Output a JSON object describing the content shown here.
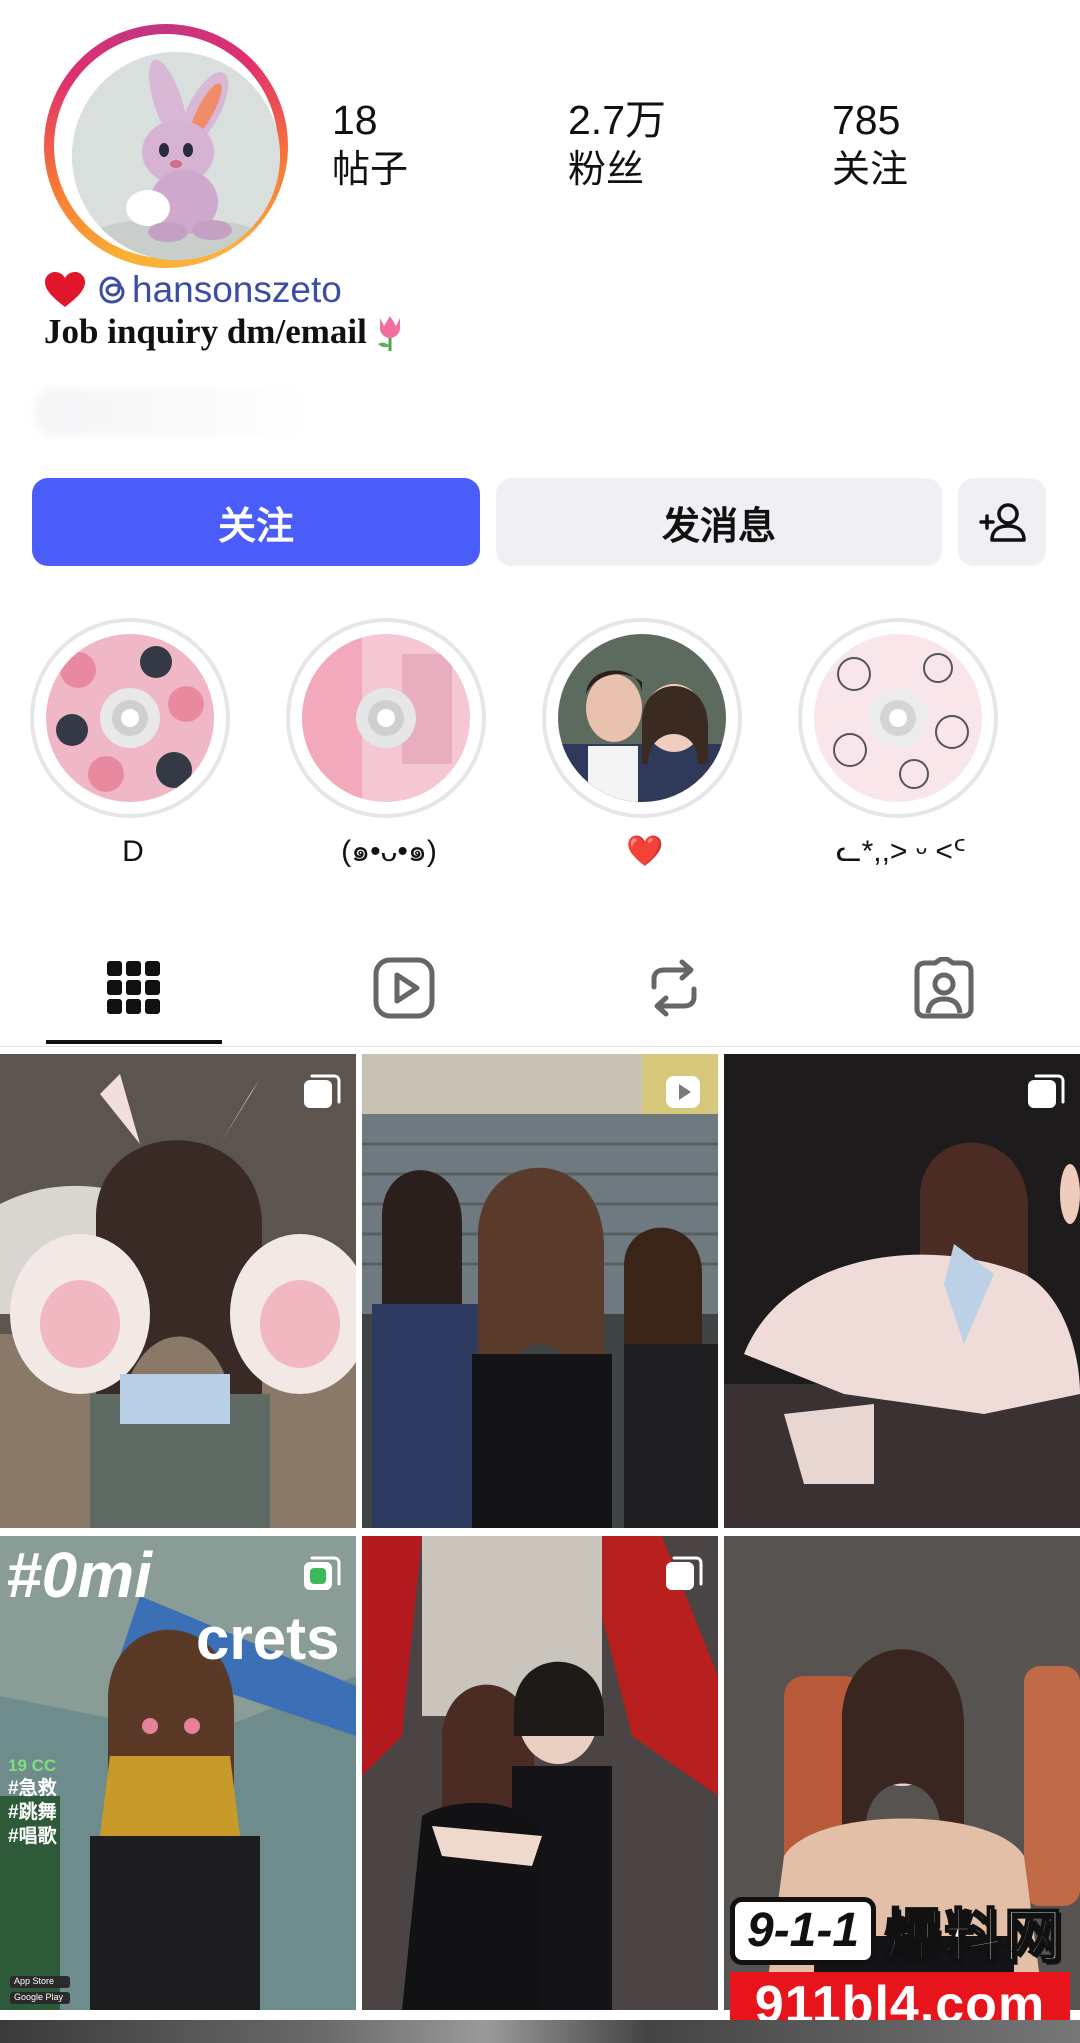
{
  "profile": {
    "handle_prefix_icon": "threads-icon",
    "handle": "hansonszeto",
    "bio": "Job inquiry dm/email",
    "bio_emoji": "🌷",
    "name_emoji": "❤️"
  },
  "stats": [
    {
      "value": "18",
      "label": "帖子"
    },
    {
      "value": "2.7万",
      "label": "粉丝"
    },
    {
      "value": "785",
      "label": "关注"
    }
  ],
  "actions": {
    "follow_label": "关注",
    "message_label": "发消息",
    "add_user_icon": "add-user-icon"
  },
  "highlights": [
    {
      "label": "D"
    },
    {
      "label": "(๑•ᴗ•๑)"
    },
    {
      "label": "❤️"
    },
    {
      "label": "ᓚ*,,> ᵕ <ᑦ"
    }
  ],
  "tabs": [
    {
      "icon": "grid-icon",
      "active": true
    },
    {
      "icon": "reels-icon",
      "active": false
    },
    {
      "icon": "repost-icon",
      "active": false
    },
    {
      "icon": "tagged-icon",
      "active": false
    }
  ],
  "posts": {
    "tile4_overlay_title": "#0mi",
    "tile4_overlay_title2": "crets",
    "tile4_tag_1": "19 CC",
    "tile4_tag_2": "#急救",
    "tile4_tag_3": "#跳舞",
    "tile4_tag_4": "#唱歌",
    "tile4_store_1": "App Store",
    "tile4_store_2": "Google Play"
  },
  "watermark": {
    "box_text": "9-1-1",
    "cn_text": "爆料网",
    "url": "911bl4.com"
  },
  "colors": {
    "follow_button": "#4a5df9",
    "secondary_button": "#efeff4",
    "handle_color": "#3b4ea3",
    "watermark_red": "#e8141b"
  }
}
